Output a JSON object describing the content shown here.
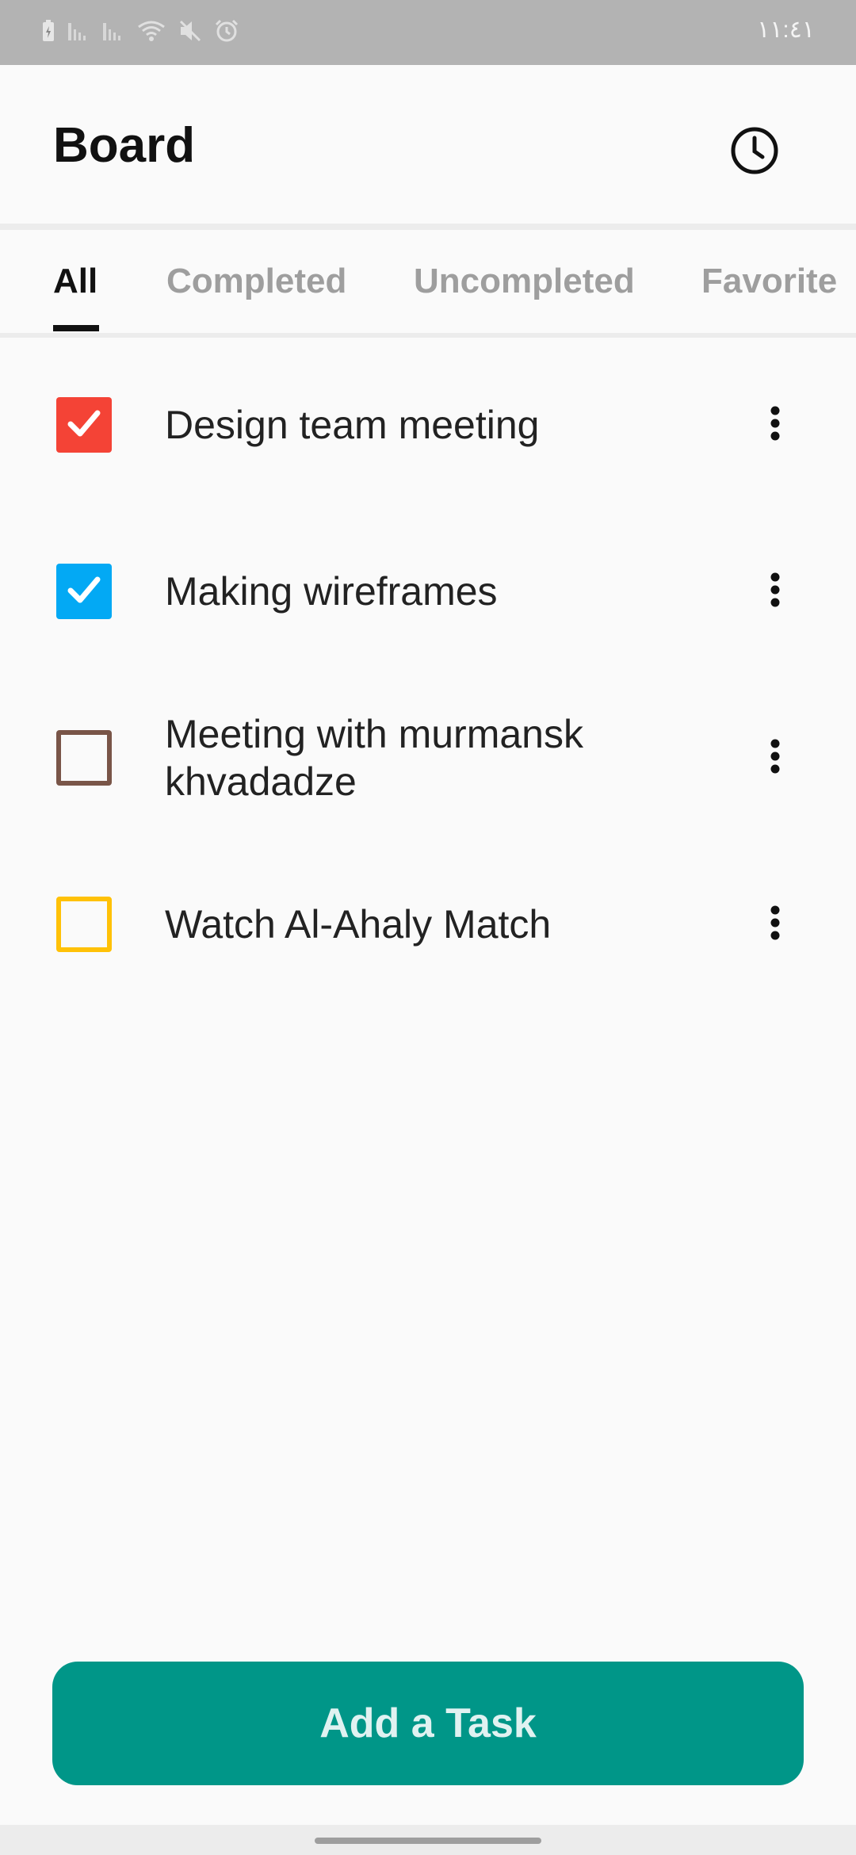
{
  "status_bar": {
    "time": "١١:٤١",
    "icons": [
      "battery-icon",
      "signal-icon",
      "signal-icon",
      "wifi-icon",
      "mute-icon",
      "alarm-icon"
    ]
  },
  "header": {
    "title": "Board",
    "history_icon": "clock-icon"
  },
  "tabs": [
    {
      "label": "All",
      "active": true
    },
    {
      "label": "Completed",
      "active": false
    },
    {
      "label": "Uncompleted",
      "active": false
    },
    {
      "label": "Favorite",
      "active": false
    }
  ],
  "tasks": [
    {
      "title": "Design team meeting",
      "checked": true,
      "color": "#f44336"
    },
    {
      "title": "Making wireframes",
      "checked": true,
      "color": "#03a9f4"
    },
    {
      "title": "Meeting with murmansk khvadadze",
      "checked": false,
      "color": "#795548"
    },
    {
      "title": "Watch Al-Ahaly Match",
      "checked": false,
      "color": "#ffc107"
    }
  ],
  "add_button": {
    "label": "Add a Task",
    "color": "#009688"
  }
}
